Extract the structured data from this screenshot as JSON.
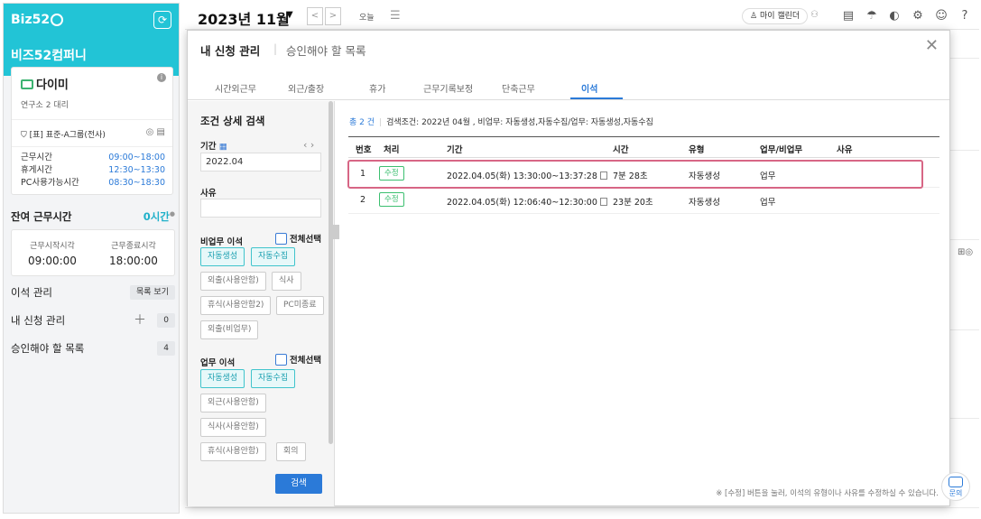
{
  "sidebar": {
    "logo": "Biz52",
    "company": "비즈52컴퍼니",
    "user": {
      "name": "다이미",
      "dept": "연구소 2 대리",
      "group": "[표] 표준-A그룹(전사)",
      "rows": [
        {
          "label": "근무시간",
          "value": "09:00~18:00"
        },
        {
          "label": "휴게시간",
          "value": "12:30~13:30"
        },
        {
          "label": "PC사용가능시간",
          "value": "08:30~18:30"
        }
      ]
    },
    "remain_label": "잔여 근무시간",
    "remain_value": "0시간",
    "start_label": "근무시작시각",
    "start_value": "09:00:00",
    "end_label": "근무종료시각",
    "end_value": "18:00:00",
    "links": {
      "leave_mgmt": "이석 관리",
      "leave_mgmt_btn": "목록 보기",
      "my_request": "내 신청 관리",
      "my_request_count": "0",
      "approval": "승인해야 할 목록",
      "approval_count": "4"
    }
  },
  "topbar": {
    "month": "2023년 11월",
    "today": "오늘",
    "my_calendar": "마이 캘린더"
  },
  "modal": {
    "title": "내 신청 관리",
    "title2": "승인해야 할 목록",
    "tabs": [
      "시간외근무",
      "외근/출장",
      "휴가",
      "근무기록보정",
      "단축근무",
      "이석"
    ],
    "active_tab": "이석",
    "filter": {
      "title": "조건 상세 검색",
      "period_label": "기간",
      "period_value": "2022.04",
      "reason_label": "사유",
      "reason_value": "",
      "non_work_label": "비업무 이석",
      "select_all": "전체선택",
      "non_work_options": [
        {
          "label": "자동생성",
          "on": true
        },
        {
          "label": "자동수집",
          "on": true
        },
        {
          "label": "외출(사용안함)",
          "on": false
        },
        {
          "label": "식사",
          "on": false
        },
        {
          "label": "휴식(사용안함2)",
          "on": false
        },
        {
          "label": "PC미종료",
          "on": false
        },
        {
          "label": "외출(비업무)",
          "on": false
        }
      ],
      "work_label": "업무 이석",
      "work_options": [
        {
          "label": "자동생성",
          "on": true
        },
        {
          "label": "자동수집",
          "on": true
        },
        {
          "label": "외근(사용안함)",
          "on": false
        },
        {
          "label": "식사(사용안함)",
          "on": false
        },
        {
          "label": "휴식(사용안함)",
          "on": false
        },
        {
          "label": "회의",
          "on": false
        }
      ],
      "search_btn": "검색"
    },
    "summary": {
      "count": "총 2 건",
      "conditions": "검색조건: 2022년 04월 , 비업무: 자동생성,자동수집/업무: 자동생성,자동수집"
    },
    "table": {
      "headers": [
        "번호",
        "처리",
        "기간",
        "시간",
        "유형",
        "업무/비업무",
        "사유"
      ],
      "rows": [
        {
          "no": "1",
          "action": "수정",
          "period": "2022.04.05(화) 13:30:00~13:37:28",
          "time": "7분 28초",
          "type": "자동생성",
          "work": "업무",
          "reason": ""
        },
        {
          "no": "2",
          "action": "수정",
          "period": "2022.04.05(화) 12:06:40~12:30:00",
          "time": "23분 20초",
          "type": "자동생성",
          "work": "업무",
          "reason": ""
        }
      ]
    },
    "footnote": "※ [수정] 버튼을 눌러, 이석의 유형이나 사유를 수정하실 수 있습니다.",
    "chat_label": "문의"
  },
  "colors": {
    "brand": "#22c4d6",
    "accent": "#2b7ad8",
    "highlight": "#d76685",
    "badge": "#3cbf70"
  }
}
